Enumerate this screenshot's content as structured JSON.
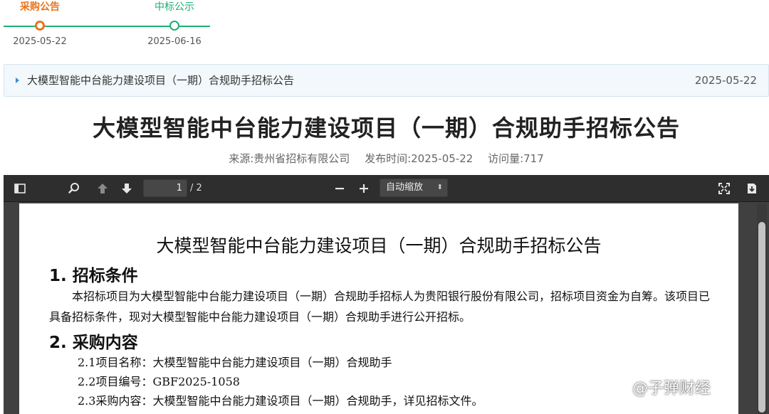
{
  "timeline": {
    "steps": [
      {
        "label": "采购公告",
        "date": "2025-05-22"
      },
      {
        "label": "中标公示",
        "date": "2025-06-16"
      }
    ]
  },
  "notice_bar": {
    "title": "大模型智能中台能力建设项目（一期）合规助手招标公告",
    "date": "2025-05-22"
  },
  "header": {
    "title": "大模型智能中台能力建设项目（一期）合规助手招标公告",
    "source": "来源:贵州省招标有限公司",
    "publish_time": "发布时间:2025-05-22",
    "visits": "访问量:717"
  },
  "pdf_toolbar": {
    "current_page": "1",
    "total_pages": "/ 2",
    "zoom": "自动缩放",
    "icons": [
      "sidebar-toggle-icon",
      "search-icon",
      "arrow-up-icon",
      "arrow-down-icon",
      "minus-icon",
      "plus-icon",
      "fullscreen-icon",
      "download-icon"
    ]
  },
  "document": {
    "title": "大模型智能中台能力建设项目（一期）合规助手招标公告",
    "section1_heading": "1. 招标条件",
    "section1_text": "本招标项目为大模型智能中台能力建设项目（一期）合规助手招标人为贵阳银行股份有限公司，招标项目资金为自筹。该项目已具备招标条件，现对大模型智能中台能力建设项目（一期）合规助手进行公开招标。",
    "section2_heading": "2. 采购内容",
    "items": [
      "2.1项目名称：大模型智能中台能力建设项目（一期）合规助手",
      "2.2项目编号：GBF2025-1058",
      "2.3采购内容：大模型智能中台能力建设项目（一期）合规助手，详见招标文件。"
    ]
  },
  "watermark": "@子弹财经",
  "colors": {
    "accent_orange": "#e8741e",
    "accent_green": "#1fae72",
    "toolbar_bg": "#2e2e2e"
  }
}
